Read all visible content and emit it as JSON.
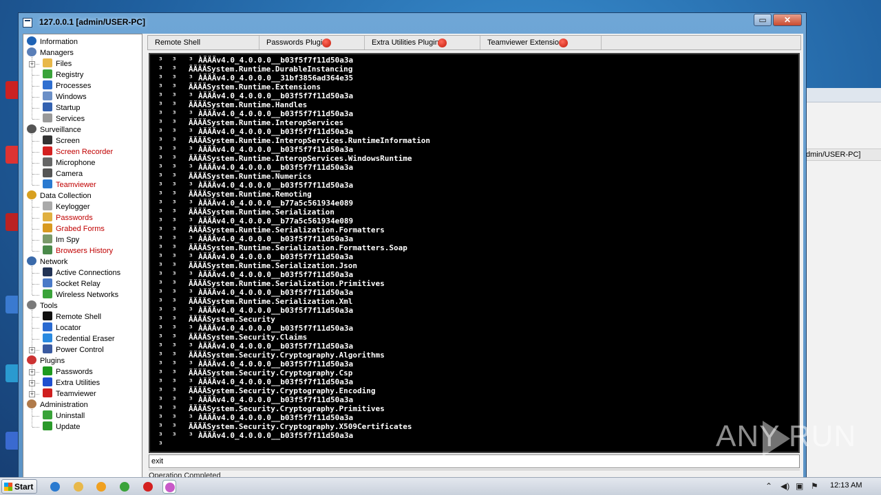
{
  "window": {
    "title": "127.0.0.1 [admin/USER-PC]",
    "restore_glyph": "▭",
    "close_glyph": "✕"
  },
  "background_window": {
    "row_text": "dmin/USER-PC]"
  },
  "sidebar": {
    "groups": [
      {
        "label": "Information",
        "icon": "info-icon",
        "color": "#1f63b5",
        "items": []
      },
      {
        "label": "Managers",
        "icon": "managers-icon",
        "color": "#5a7fb8",
        "items": [
          {
            "label": "Files",
            "icon": "folder-icon",
            "color": "#e8b84a",
            "expandable": true,
            "red": false
          },
          {
            "label": "Registry",
            "icon": "registry-icon",
            "color": "#3aa33a",
            "expandable": false,
            "red": false
          },
          {
            "label": "Processes",
            "icon": "processes-icon",
            "color": "#2f6fd0",
            "expandable": false,
            "red": false
          },
          {
            "label": "Windows",
            "icon": "windows-icon",
            "color": "#6b8fc7",
            "expandable": false,
            "red": false
          },
          {
            "label": "Startup",
            "icon": "startup-icon",
            "color": "#3462b0",
            "expandable": false,
            "red": false
          },
          {
            "label": "Services",
            "icon": "services-icon",
            "color": "#999999",
            "expandable": false,
            "red": false
          }
        ]
      },
      {
        "label": "Surveillance",
        "icon": "surveillance-icon",
        "color": "#555555",
        "items": [
          {
            "label": "Screen",
            "icon": "screen-icon",
            "color": "#333333",
            "expandable": false,
            "red": false
          },
          {
            "label": "Screen Recorder",
            "icon": "screen-recorder-icon",
            "color": "#d42020",
            "expandable": false,
            "red": true
          },
          {
            "label": "Microphone",
            "icon": "microphone-icon",
            "color": "#666666",
            "expandable": false,
            "red": false
          },
          {
            "label": "Camera",
            "icon": "camera-icon",
            "color": "#555555",
            "expandable": false,
            "red": false
          },
          {
            "label": "Teamviewer",
            "icon": "teamviewer-icon",
            "color": "#2a7ad0",
            "expandable": false,
            "red": true
          }
        ]
      },
      {
        "label": "Data Collection",
        "icon": "data-collection-icon",
        "color": "#d8a020",
        "items": [
          {
            "label": "Keylogger",
            "icon": "keyboard-icon",
            "color": "#aaaaaa",
            "expandable": false,
            "red": false
          },
          {
            "label": "Passwords",
            "icon": "key-icon",
            "color": "#e0b040",
            "expandable": false,
            "red": true
          },
          {
            "label": "Grabed Forms",
            "icon": "lock-icon",
            "color": "#d89a20",
            "expandable": false,
            "red": true
          },
          {
            "label": "Im Spy",
            "icon": "im-spy-icon",
            "color": "#7a9a6a",
            "expandable": false,
            "red": false
          },
          {
            "label": "Browsers History",
            "icon": "history-icon",
            "color": "#4a8a4a",
            "expandable": false,
            "red": true
          }
        ]
      },
      {
        "label": "Network",
        "icon": "network-icon",
        "color": "#3a6aaa",
        "items": [
          {
            "label": "Active Connections",
            "icon": "globe-icon",
            "color": "#223355",
            "expandable": false,
            "red": false
          },
          {
            "label": "Socket Relay",
            "icon": "relay-icon",
            "color": "#4a7ac8",
            "expandable": false,
            "red": false
          },
          {
            "label": "Wireless Networks",
            "icon": "wifi-icon",
            "color": "#3aa33a",
            "expandable": false,
            "red": false
          }
        ]
      },
      {
        "label": "Tools",
        "icon": "tools-icon",
        "color": "#7a7a7a",
        "items": [
          {
            "label": "Remote Shell",
            "icon": "terminal-icon",
            "color": "#111111",
            "expandable": false,
            "red": false
          },
          {
            "label": "Locator",
            "icon": "locator-icon",
            "color": "#2a6ad0",
            "expandable": false,
            "red": false
          },
          {
            "label": "Credential Eraser",
            "icon": "eraser-icon",
            "color": "#2a8ae0",
            "expandable": false,
            "red": false
          },
          {
            "label": "Power Control",
            "icon": "power-icon",
            "color": "#3a5aa0",
            "expandable": true,
            "red": false
          }
        ]
      },
      {
        "label": "Plugins",
        "icon": "plugins-icon",
        "color": "#cc3333",
        "items": [
          {
            "label": "Passwords",
            "icon": "plugin-green-icon",
            "color": "#1f9a1f",
            "expandable": true,
            "red": false
          },
          {
            "label": "Extra Utilities",
            "icon": "plugin-blue-icon",
            "color": "#1f4fcf",
            "expandable": true,
            "red": false
          },
          {
            "label": "Teamviewer",
            "icon": "plugin-red-icon",
            "color": "#cf1f1f",
            "expandable": true,
            "red": false
          }
        ]
      },
      {
        "label": "Administration",
        "icon": "administration-icon",
        "color": "#b07a4a",
        "items": [
          {
            "label": "Uninstall",
            "icon": "recycle-icon",
            "color": "#3aa33a",
            "expandable": false,
            "red": false
          },
          {
            "label": "Update",
            "icon": "update-icon",
            "color": "#2a9a2a",
            "expandable": false,
            "red": false
          }
        ]
      }
    ]
  },
  "tabs": [
    {
      "label": "Remote Shell",
      "has_dot": false
    },
    {
      "label": "Passwords Plugin",
      "has_dot": true
    },
    {
      "label": "Extra Utilities Plugin",
      "has_dot": true
    },
    {
      "label": "Teamviewer Extension",
      "has_dot": true
    }
  ],
  "console": {
    "marker_pair": "³  ³",
    "marker_single": "³",
    "lines": [
      {
        "text": "ÀÄÄÄv4.0_4.0.0.0__b03f5f7f11d50a3a",
        "deep": true
      },
      {
        "text": "ÃÄÄÄSystem.Runtime.DurableInstancing",
        "deep": false
      },
      {
        "text": "ÀÄÄÄv4.0_4.0.0.0__31bf3856ad364e35",
        "deep": true
      },
      {
        "text": "ÃÄÄÄSystem.Runtime.Extensions",
        "deep": false
      },
      {
        "text": "ÀÄÄÄv4.0_4.0.0.0__b03f5f7f11d50a3a",
        "deep": true
      },
      {
        "text": "ÃÄÄÄSystem.Runtime.Handles",
        "deep": false
      },
      {
        "text": "ÀÄÄÄv4.0_4.0.0.0__b03f5f7f11d50a3a",
        "deep": true
      },
      {
        "text": "ÃÄÄÄSystem.Runtime.InteropServices",
        "deep": false
      },
      {
        "text": "ÀÄÄÄv4.0_4.0.0.0__b03f5f7f11d50a3a",
        "deep": true
      },
      {
        "text": "ÃÄÄÄSystem.Runtime.InteropServices.RuntimeInformation",
        "deep": false
      },
      {
        "text": "ÀÄÄÄv4.0_4.0.0.0__b03f5f7f11d50a3a",
        "deep": true
      },
      {
        "text": "ÃÄÄÄSystem.Runtime.InteropServices.WindowsRuntime",
        "deep": false
      },
      {
        "text": "ÀÄÄÄv4.0_4.0.0.0__b03f5f7f11d50a3a",
        "deep": true
      },
      {
        "text": "ÃÄÄÄSystem.Runtime.Numerics",
        "deep": false
      },
      {
        "text": "ÀÄÄÄv4.0_4.0.0.0__b03f5f7f11d50a3a",
        "deep": true
      },
      {
        "text": "ÃÄÄÄSystem.Runtime.Remoting",
        "deep": false
      },
      {
        "text": "ÀÄÄÄv4.0_4.0.0.0__b77a5c561934e089",
        "deep": true
      },
      {
        "text": "ÃÄÄÄSystem.Runtime.Serialization",
        "deep": false
      },
      {
        "text": "ÀÄÄÄv4.0_4.0.0.0__b77a5c561934e089",
        "deep": true
      },
      {
        "text": "ÃÄÄÄSystem.Runtime.Serialization.Formatters",
        "deep": false
      },
      {
        "text": "ÀÄÄÄv4.0_4.0.0.0__b03f5f7f11d50a3a",
        "deep": true
      },
      {
        "text": "ÃÄÄÄSystem.Runtime.Serialization.Formatters.Soap",
        "deep": false
      },
      {
        "text": "ÀÄÄÄv4.0_4.0.0.0__b03f5f7f11d50a3a",
        "deep": true
      },
      {
        "text": "ÃÄÄÄSystem.Runtime.Serialization.Json",
        "deep": false
      },
      {
        "text": "ÀÄÄÄv4.0_4.0.0.0__b03f5f7f11d50a3a",
        "deep": true
      },
      {
        "text": "ÃÄÄÄSystem.Runtime.Serialization.Primitives",
        "deep": false
      },
      {
        "text": "ÀÄÄÄv4.0_4.0.0.0__b03f5f7f11d50a3a",
        "deep": true
      },
      {
        "text": "ÃÄÄÄSystem.Runtime.Serialization.Xml",
        "deep": false
      },
      {
        "text": "ÀÄÄÄv4.0_4.0.0.0__b03f5f7f11d50a3a",
        "deep": true
      },
      {
        "text": "ÃÄÄÄSystem.Security",
        "deep": false
      },
      {
        "text": "ÀÄÄÄv4.0_4.0.0.0__b03f5f7f11d50a3a",
        "deep": true
      },
      {
        "text": "ÃÄÄÄSystem.Security.Claims",
        "deep": false
      },
      {
        "text": "ÀÄÄÄv4.0_4.0.0.0__b03f5f7f11d50a3a",
        "deep": true
      },
      {
        "text": "ÃÄÄÄSystem.Security.Cryptography.Algorithms",
        "deep": false
      },
      {
        "text": "ÀÄÄÄv4.0_4.0.0.0__b03f5f7f11d50a3a",
        "deep": true
      },
      {
        "text": "ÃÄÄÄSystem.Security.Cryptography.Csp",
        "deep": false
      },
      {
        "text": "ÀÄÄÄv4.0_4.0.0.0__b03f5f7f11d50a3a",
        "deep": true
      },
      {
        "text": "ÃÄÄÄSystem.Security.Cryptography.Encoding",
        "deep": false
      },
      {
        "text": "ÀÄÄÄv4.0_4.0.0.0__b03f5f7f11d50a3a",
        "deep": true
      },
      {
        "text": "ÃÄÄÄSystem.Security.Cryptography.Primitives",
        "deep": false
      },
      {
        "text": "ÀÄÄÄv4.0_4.0.0.0__b03f5f7f11d50a3a",
        "deep": true
      },
      {
        "text": "ÃÄÄÄSystem.Security.Cryptography.X509Certificates",
        "deep": false
      },
      {
        "text": "ÀÄÄÄv4.0_4.0.0.0__b03f5f7f11d50a3a",
        "deep": true
      },
      {
        "text": "",
        "deep": false,
        "single": true
      }
    ]
  },
  "command_input": {
    "value": "exit"
  },
  "status_bar": {
    "text": "Operation Completed"
  },
  "watermark": {
    "text": "ANY   RUN"
  },
  "taskbar": {
    "start_label": "Start",
    "apps": [
      {
        "name": "ie-icon",
        "color": "#2a7ad0",
        "active": false
      },
      {
        "name": "explorer-icon",
        "color": "#e8b84a",
        "active": false
      },
      {
        "name": "media-player-icon",
        "color": "#f0a020",
        "active": false
      },
      {
        "name": "chrome-icon",
        "color": "#3aa33a",
        "active": false
      },
      {
        "name": "opera-icon",
        "color": "#d42020",
        "active": false
      },
      {
        "name": "rat-app-icon",
        "color": "#c85ac8",
        "active": true
      }
    ],
    "clock": "12:13 AM"
  }
}
